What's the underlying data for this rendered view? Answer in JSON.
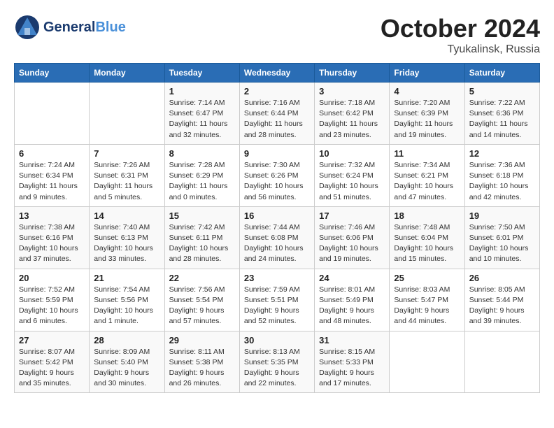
{
  "header": {
    "logo_line1": "General",
    "logo_line2": "Blue",
    "month": "October 2024",
    "location": "Tyukalinsk, Russia"
  },
  "days_of_week": [
    "Sunday",
    "Monday",
    "Tuesday",
    "Wednesday",
    "Thursday",
    "Friday",
    "Saturday"
  ],
  "weeks": [
    [
      {
        "day": "",
        "empty": true
      },
      {
        "day": "",
        "empty": true
      },
      {
        "day": "1",
        "sunrise": "7:14 AM",
        "sunset": "6:47 PM",
        "daylight": "11 hours and 32 minutes."
      },
      {
        "day": "2",
        "sunrise": "7:16 AM",
        "sunset": "6:44 PM",
        "daylight": "11 hours and 28 minutes."
      },
      {
        "day": "3",
        "sunrise": "7:18 AM",
        "sunset": "6:42 PM",
        "daylight": "11 hours and 23 minutes."
      },
      {
        "day": "4",
        "sunrise": "7:20 AM",
        "sunset": "6:39 PM",
        "daylight": "11 hours and 19 minutes."
      },
      {
        "day": "5",
        "sunrise": "7:22 AM",
        "sunset": "6:36 PM",
        "daylight": "11 hours and 14 minutes."
      }
    ],
    [
      {
        "day": "6",
        "sunrise": "7:24 AM",
        "sunset": "6:34 PM",
        "daylight": "11 hours and 9 minutes."
      },
      {
        "day": "7",
        "sunrise": "7:26 AM",
        "sunset": "6:31 PM",
        "daylight": "11 hours and 5 minutes."
      },
      {
        "day": "8",
        "sunrise": "7:28 AM",
        "sunset": "6:29 PM",
        "daylight": "11 hours and 0 minutes."
      },
      {
        "day": "9",
        "sunrise": "7:30 AM",
        "sunset": "6:26 PM",
        "daylight": "10 hours and 56 minutes."
      },
      {
        "day": "10",
        "sunrise": "7:32 AM",
        "sunset": "6:24 PM",
        "daylight": "10 hours and 51 minutes."
      },
      {
        "day": "11",
        "sunrise": "7:34 AM",
        "sunset": "6:21 PM",
        "daylight": "10 hours and 47 minutes."
      },
      {
        "day": "12",
        "sunrise": "7:36 AM",
        "sunset": "6:18 PM",
        "daylight": "10 hours and 42 minutes."
      }
    ],
    [
      {
        "day": "13",
        "sunrise": "7:38 AM",
        "sunset": "6:16 PM",
        "daylight": "10 hours and 37 minutes."
      },
      {
        "day": "14",
        "sunrise": "7:40 AM",
        "sunset": "6:13 PM",
        "daylight": "10 hours and 33 minutes."
      },
      {
        "day": "15",
        "sunrise": "7:42 AM",
        "sunset": "6:11 PM",
        "daylight": "10 hours and 28 minutes."
      },
      {
        "day": "16",
        "sunrise": "7:44 AM",
        "sunset": "6:08 PM",
        "daylight": "10 hours and 24 minutes."
      },
      {
        "day": "17",
        "sunrise": "7:46 AM",
        "sunset": "6:06 PM",
        "daylight": "10 hours and 19 minutes."
      },
      {
        "day": "18",
        "sunrise": "7:48 AM",
        "sunset": "6:04 PM",
        "daylight": "10 hours and 15 minutes."
      },
      {
        "day": "19",
        "sunrise": "7:50 AM",
        "sunset": "6:01 PM",
        "daylight": "10 hours and 10 minutes."
      }
    ],
    [
      {
        "day": "20",
        "sunrise": "7:52 AM",
        "sunset": "5:59 PM",
        "daylight": "10 hours and 6 minutes."
      },
      {
        "day": "21",
        "sunrise": "7:54 AM",
        "sunset": "5:56 PM",
        "daylight": "10 hours and 1 minute."
      },
      {
        "day": "22",
        "sunrise": "7:56 AM",
        "sunset": "5:54 PM",
        "daylight": "9 hours and 57 minutes."
      },
      {
        "day": "23",
        "sunrise": "7:59 AM",
        "sunset": "5:51 PM",
        "daylight": "9 hours and 52 minutes."
      },
      {
        "day": "24",
        "sunrise": "8:01 AM",
        "sunset": "5:49 PM",
        "daylight": "9 hours and 48 minutes."
      },
      {
        "day": "25",
        "sunrise": "8:03 AM",
        "sunset": "5:47 PM",
        "daylight": "9 hours and 44 minutes."
      },
      {
        "day": "26",
        "sunrise": "8:05 AM",
        "sunset": "5:44 PM",
        "daylight": "9 hours and 39 minutes."
      }
    ],
    [
      {
        "day": "27",
        "sunrise": "8:07 AM",
        "sunset": "5:42 PM",
        "daylight": "9 hours and 35 minutes."
      },
      {
        "day": "28",
        "sunrise": "8:09 AM",
        "sunset": "5:40 PM",
        "daylight": "9 hours and 30 minutes."
      },
      {
        "day": "29",
        "sunrise": "8:11 AM",
        "sunset": "5:38 PM",
        "daylight": "9 hours and 26 minutes."
      },
      {
        "day": "30",
        "sunrise": "8:13 AM",
        "sunset": "5:35 PM",
        "daylight": "9 hours and 22 minutes."
      },
      {
        "day": "31",
        "sunrise": "8:15 AM",
        "sunset": "5:33 PM",
        "daylight": "9 hours and 17 minutes."
      },
      {
        "day": "",
        "empty": true
      },
      {
        "day": "",
        "empty": true
      }
    ]
  ]
}
